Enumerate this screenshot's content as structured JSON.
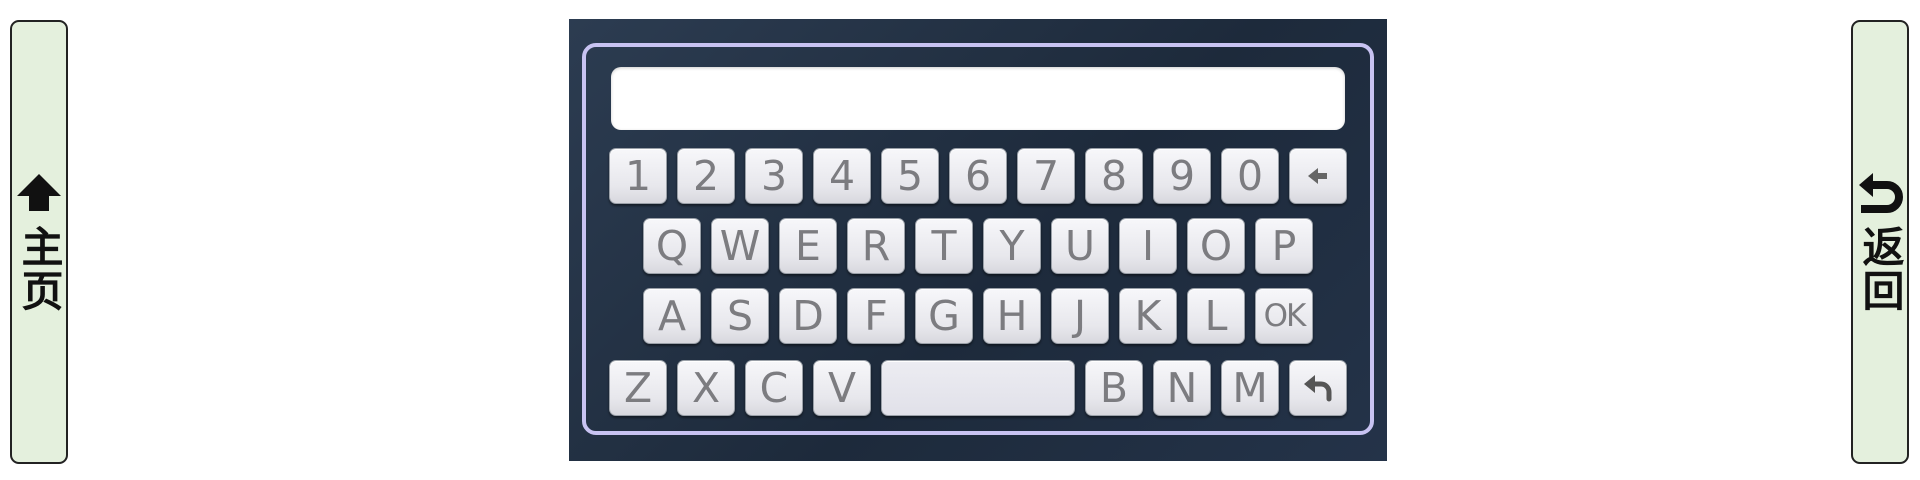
{
  "side_buttons": {
    "home": {
      "label": "主页",
      "icon": "home-up-arrow-icon"
    },
    "back": {
      "label": "返回",
      "icon": "return-arrow-icon"
    }
  },
  "display": {
    "value": ""
  },
  "keyboard": {
    "number_row": [
      "1",
      "2",
      "3",
      "4",
      "5",
      "6",
      "7",
      "8",
      "9",
      "0"
    ],
    "row_q": [
      "Q",
      "W",
      "E",
      "R",
      "T",
      "Y",
      "U",
      "I",
      "O",
      "P"
    ],
    "row_a": [
      "A",
      "S",
      "D",
      "F",
      "G",
      "H",
      "J",
      "K",
      "L"
    ],
    "row_z_left": [
      "Z",
      "X",
      "C",
      "V"
    ],
    "row_z_right": [
      "B",
      "N",
      "M"
    ],
    "ok_label": "OK",
    "backspace_icon": "backspace-arrow-icon",
    "enter_icon": "enter-return-icon",
    "space_label": ""
  },
  "colors": {
    "panel_bg": "#24334a",
    "frame_border": "#c8c3f2",
    "side_button_bg": "#e4f0dd",
    "key_text": "#7c7c80"
  }
}
